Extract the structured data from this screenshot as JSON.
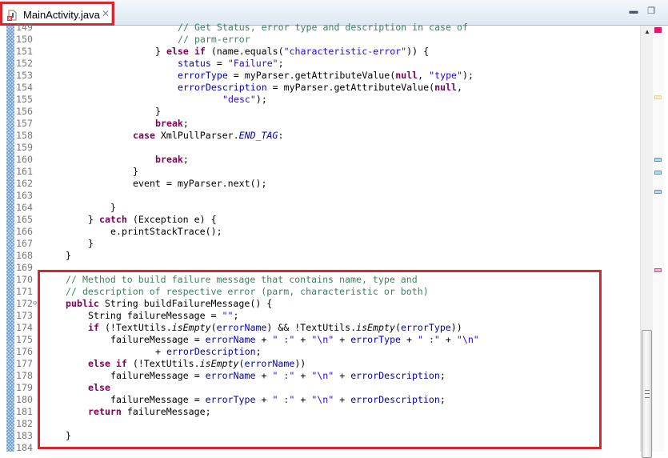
{
  "tab": {
    "title": "MainActivity.java",
    "file_icon": "java-file-error-icon",
    "close_icon": "close-icon"
  },
  "window_controls": {
    "minimize_icon": "minimize-icon",
    "restore_icon": "restore-icon"
  },
  "colors": {
    "keyword": "#7f0055",
    "comment": "#3f7f5f",
    "string": "#2a00ff",
    "field": "#0000c0",
    "highlight_box": "#d7262c"
  },
  "overview_marks": [
    {
      "kind": "error",
      "color": "#e0186c"
    },
    {
      "kind": "warning",
      "color": "#f3d77a"
    },
    {
      "kind": "occurrence",
      "color": "#5b9bd5"
    },
    {
      "kind": "occurrence",
      "color": "#5b9bd5"
    },
    {
      "kind": "occurrence",
      "color": "#5b9bd5"
    },
    {
      "kind": "task",
      "color": "#d05090"
    }
  ],
  "scrollbar": {
    "position_percent": 100
  },
  "lines": [
    {
      "n": "149",
      "indent": 24,
      "tokens": [
        [
          "c",
          "// Get Status, error type and description in case of"
        ]
      ]
    },
    {
      "n": "150",
      "indent": 24,
      "tokens": [
        [
          "c",
          "// parm-error"
        ]
      ]
    },
    {
      "n": "151",
      "indent": 20,
      "tokens": [
        [
          "p",
          "} "
        ],
        [
          "k",
          "else"
        ],
        [
          "p",
          " "
        ],
        [
          "k",
          "if"
        ],
        [
          "p",
          " (name.equals("
        ],
        [
          "s",
          "\"characteristic-error\""
        ],
        [
          "p",
          ")) {"
        ]
      ]
    },
    {
      "n": "152",
      "indent": 24,
      "tokens": [
        [
          "f",
          "status"
        ],
        [
          "p",
          " = "
        ],
        [
          "s",
          "\"Failure\""
        ],
        [
          "p",
          ";"
        ]
      ]
    },
    {
      "n": "153",
      "indent": 24,
      "tokens": [
        [
          "f",
          "errorType"
        ],
        [
          "p",
          " = myParser.getAttributeValue("
        ],
        [
          "k",
          "null"
        ],
        [
          "p",
          ", "
        ],
        [
          "s",
          "\"type\""
        ],
        [
          "p",
          ");"
        ]
      ]
    },
    {
      "n": "154",
      "indent": 24,
      "tokens": [
        [
          "f",
          "errorDescription"
        ],
        [
          "p",
          " = myParser.getAttributeValue("
        ],
        [
          "k",
          "null"
        ],
        [
          "p",
          ","
        ]
      ]
    },
    {
      "n": "155",
      "indent": 32,
      "tokens": [
        [
          "s",
          "\"desc\""
        ],
        [
          "p",
          ");"
        ]
      ]
    },
    {
      "n": "156",
      "indent": 20,
      "tokens": [
        [
          "p",
          "}"
        ]
      ]
    },
    {
      "n": "157",
      "indent": 20,
      "tokens": [
        [
          "k",
          "break"
        ],
        [
          "p",
          ";"
        ]
      ]
    },
    {
      "n": "158",
      "indent": 16,
      "tokens": [
        [
          "k",
          "case"
        ],
        [
          "p",
          " XmlPullParser."
        ],
        [
          "fi",
          "END_TAG"
        ],
        [
          "p",
          ":"
        ]
      ]
    },
    {
      "n": "159",
      "indent": 0,
      "tokens": []
    },
    {
      "n": "160",
      "indent": 20,
      "tokens": [
        [
          "k",
          "break"
        ],
        [
          "p",
          ";"
        ]
      ]
    },
    {
      "n": "161",
      "indent": 16,
      "tokens": [
        [
          "p",
          "}"
        ]
      ]
    },
    {
      "n": "162",
      "indent": 16,
      "tokens": [
        [
          "p",
          "event = myParser.next();"
        ]
      ]
    },
    {
      "n": "163",
      "indent": 0,
      "tokens": []
    },
    {
      "n": "164",
      "indent": 12,
      "tokens": [
        [
          "p",
          "}"
        ]
      ]
    },
    {
      "n": "165",
      "indent": 8,
      "tokens": [
        [
          "p",
          "} "
        ],
        [
          "k",
          "catch"
        ],
        [
          "p",
          " (Exception e) {"
        ]
      ]
    },
    {
      "n": "166",
      "indent": 12,
      "tokens": [
        [
          "p",
          "e.printStackTrace();"
        ]
      ]
    },
    {
      "n": "167",
      "indent": 8,
      "tokens": [
        [
          "p",
          "}"
        ]
      ]
    },
    {
      "n": "168",
      "indent": 4,
      "tokens": [
        [
          "p",
          "}"
        ]
      ]
    },
    {
      "n": "169",
      "indent": 0,
      "tokens": []
    },
    {
      "n": "170",
      "indent": 4,
      "tokens": [
        [
          "c",
          "// Method to build failure message that contains name, type and"
        ]
      ]
    },
    {
      "n": "171",
      "indent": 4,
      "tokens": [
        [
          "c",
          "// description of respective error (parm, characteristic or both)"
        ]
      ]
    },
    {
      "n": "172",
      "indent": 4,
      "fold": "⊖",
      "tokens": [
        [
          "k",
          "public"
        ],
        [
          "p",
          " String buildFailureMessage() {"
        ]
      ]
    },
    {
      "n": "173",
      "indent": 8,
      "tokens": [
        [
          "p",
          "String failureMessage = "
        ],
        [
          "s",
          "\"\""
        ],
        [
          "p",
          ";"
        ]
      ]
    },
    {
      "n": "174",
      "indent": 8,
      "tokens": [
        [
          "k",
          "if"
        ],
        [
          "p",
          " (!TextUtils."
        ],
        [
          "i",
          "isEmpty"
        ],
        [
          "p",
          "("
        ],
        [
          "f",
          "errorName"
        ],
        [
          "p",
          ") && !TextUtils."
        ],
        [
          "i",
          "isEmpty"
        ],
        [
          "p",
          "("
        ],
        [
          "f",
          "errorType"
        ],
        [
          "p",
          "))"
        ]
      ]
    },
    {
      "n": "175",
      "indent": 12,
      "tokens": [
        [
          "p",
          "failureMessage = "
        ],
        [
          "f",
          "errorName"
        ],
        [
          "p",
          " + "
        ],
        [
          "s",
          "\" :\""
        ],
        [
          "p",
          " + "
        ],
        [
          "s",
          "\"\\n\""
        ],
        [
          "p",
          " + "
        ],
        [
          "f",
          "errorType"
        ],
        [
          "p",
          " + "
        ],
        [
          "s",
          "\" :\""
        ],
        [
          "p",
          " + "
        ],
        [
          "s",
          "\"\\n\""
        ]
      ]
    },
    {
      "n": "176",
      "indent": 20,
      "tokens": [
        [
          "p",
          "+ "
        ],
        [
          "f",
          "errorDescription"
        ],
        [
          "p",
          ";"
        ]
      ]
    },
    {
      "n": "177",
      "indent": 8,
      "tokens": [
        [
          "k",
          "else"
        ],
        [
          "p",
          " "
        ],
        [
          "k",
          "if"
        ],
        [
          "p",
          " (!TextUtils."
        ],
        [
          "i",
          "isEmpty"
        ],
        [
          "p",
          "("
        ],
        [
          "f",
          "errorName"
        ],
        [
          "p",
          "))"
        ]
      ]
    },
    {
      "n": "178",
      "indent": 12,
      "tokens": [
        [
          "p",
          "failureMessage = "
        ],
        [
          "f",
          "errorName"
        ],
        [
          "p",
          " + "
        ],
        [
          "s",
          "\" :\""
        ],
        [
          "p",
          " + "
        ],
        [
          "s",
          "\"\\n\""
        ],
        [
          "p",
          " + "
        ],
        [
          "f",
          "errorDescription"
        ],
        [
          "p",
          ";"
        ]
      ]
    },
    {
      "n": "179",
      "indent": 8,
      "tokens": [
        [
          "k",
          "else"
        ]
      ]
    },
    {
      "n": "180",
      "indent": 12,
      "tokens": [
        [
          "p",
          "failureMessage = "
        ],
        [
          "f",
          "errorType"
        ],
        [
          "p",
          " + "
        ],
        [
          "s",
          "\" :\""
        ],
        [
          "p",
          " + "
        ],
        [
          "s",
          "\"\\n\""
        ],
        [
          "p",
          " + "
        ],
        [
          "f",
          "errorDescription"
        ],
        [
          "p",
          ";"
        ]
      ]
    },
    {
      "n": "181",
      "indent": 8,
      "tokens": [
        [
          "k",
          "return"
        ],
        [
          "p",
          " failureMessage;"
        ]
      ]
    },
    {
      "n": "182",
      "indent": 0,
      "tokens": []
    },
    {
      "n": "183",
      "indent": 4,
      "tokens": [
        [
          "p",
          "}"
        ]
      ]
    },
    {
      "n": "184",
      "indent": 0,
      "tokens": []
    }
  ]
}
